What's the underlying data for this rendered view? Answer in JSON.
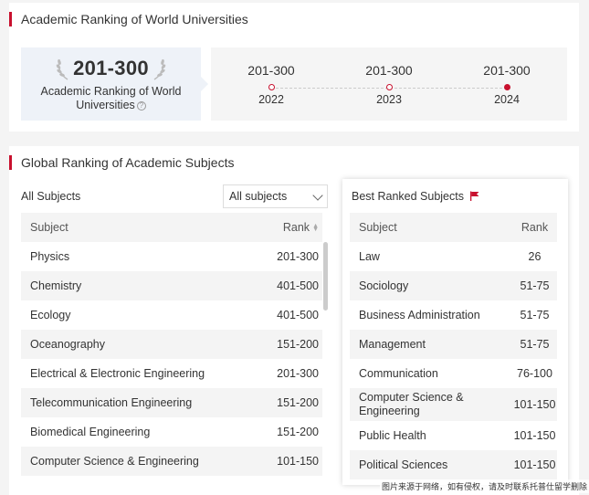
{
  "arwu": {
    "section_title": "Academic Ranking of World Universities",
    "rank": "201-300",
    "label": "Academic Ranking of World Universities",
    "info_icon": "?",
    "timeline": [
      {
        "rank": "201-300",
        "year": "2022"
      },
      {
        "rank": "201-300",
        "year": "2023"
      },
      {
        "rank": "201-300",
        "year": "2024"
      }
    ]
  },
  "subjects": {
    "section_title": "Global Ranking of Academic Subjects",
    "all_label": "All Subjects",
    "select_value": "All subjects",
    "table_headers": {
      "subject": "Subject",
      "rank": "Rank"
    },
    "rows": [
      {
        "subject": "Physics",
        "rank": "201-300"
      },
      {
        "subject": "Chemistry",
        "rank": "401-500"
      },
      {
        "subject": "Ecology",
        "rank": "401-500"
      },
      {
        "subject": "Oceanography",
        "rank": "151-200"
      },
      {
        "subject": "Electrical & Electronic Engineering",
        "rank": "201-300"
      },
      {
        "subject": "Telecommunication Engineering",
        "rank": "151-200"
      },
      {
        "subject": "Biomedical Engineering",
        "rank": "151-200"
      },
      {
        "subject": "Computer Science & Engineering",
        "rank": "101-150"
      }
    ],
    "best": {
      "title": "Best Ranked Subjects",
      "headers": {
        "subject": "Subject",
        "rank": "Rank"
      },
      "rows": [
        {
          "subject": "Law",
          "rank": "26"
        },
        {
          "subject": "Sociology",
          "rank": "51-75"
        },
        {
          "subject": "Business Administration",
          "rank": "51-75"
        },
        {
          "subject": "Management",
          "rank": "51-75"
        },
        {
          "subject": "Communication",
          "rank": "76-100"
        },
        {
          "subject": "Computer Science & Engineering",
          "rank": "101-150"
        },
        {
          "subject": "Public Health",
          "rank": "101-150"
        },
        {
          "subject": "Political Sciences",
          "rank": "101-150"
        }
      ]
    }
  },
  "watermark": "图片来源于网络，如有侵权，请及时联系托普仕留学删除",
  "colors": {
    "accent": "#c8102e",
    "highlight_bg": "#eef2f8"
  }
}
